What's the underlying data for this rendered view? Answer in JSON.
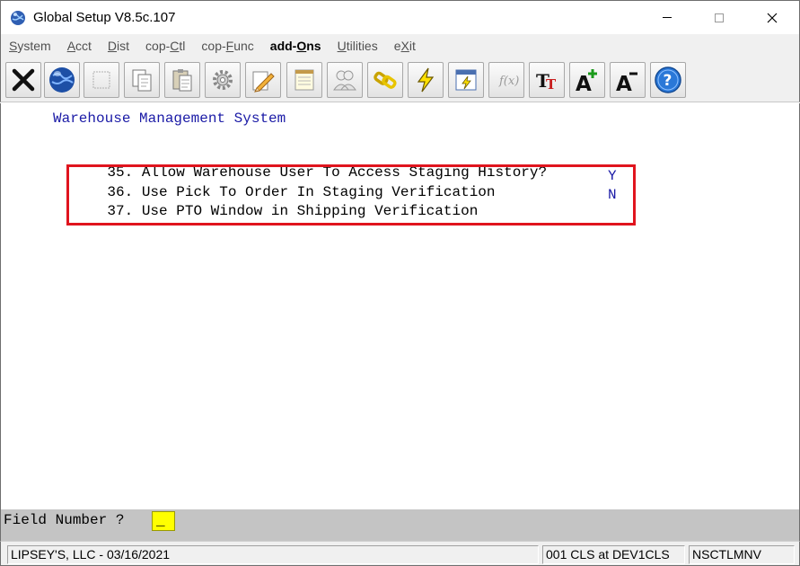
{
  "window": {
    "title": "Global Setup V8.5c.107"
  },
  "menu": [
    {
      "label": "System",
      "underline": "S"
    },
    {
      "label": "Acct",
      "underline": "A"
    },
    {
      "label": "Dist",
      "underline": "D"
    },
    {
      "label": "cop-Ctl",
      "underline": "C"
    },
    {
      "label": "cop-Func",
      "underline": "F"
    },
    {
      "label": "add-Ons",
      "underline": "O"
    },
    {
      "label": "Utilities",
      "underline": "U"
    },
    {
      "label": "eXit",
      "underline": "X"
    }
  ],
  "toolbar": {
    "icons": [
      "exit-icon",
      "globe-icon",
      "blank-icon",
      "copy-icon",
      "paste-icon",
      "settings-icon",
      "edit-icon",
      "notepad-icon",
      "users-icon",
      "link-icon",
      "lightning-icon",
      "refresh-window-icon",
      "function-icon",
      "text-size-icon",
      "font-increase-icon",
      "font-decrease-icon",
      "help-icon"
    ]
  },
  "screen": {
    "section_title": "Warehouse Management System",
    "fields": [
      {
        "number": "35.",
        "label": "Allow Warehouse User To Access Staging History?",
        "value": ""
      },
      {
        "number": "36.",
        "label": "Use Pick To Order In Staging Verification",
        "value": "Y"
      },
      {
        "number": "37.",
        "label": "Use PTO Window in Shipping Verification",
        "value": "N"
      }
    ]
  },
  "prompt": {
    "label": "Field Number ?",
    "value": "_"
  },
  "status": {
    "company": "LIPSEY'S, LLC - 03/16/2021",
    "session": "001 CLS at DEV1CLS",
    "program": "NSCTLMNV"
  },
  "colors": {
    "field_value": "#1a1aa6",
    "highlight": "#e0141e",
    "prompt_input": "#ffff00"
  }
}
